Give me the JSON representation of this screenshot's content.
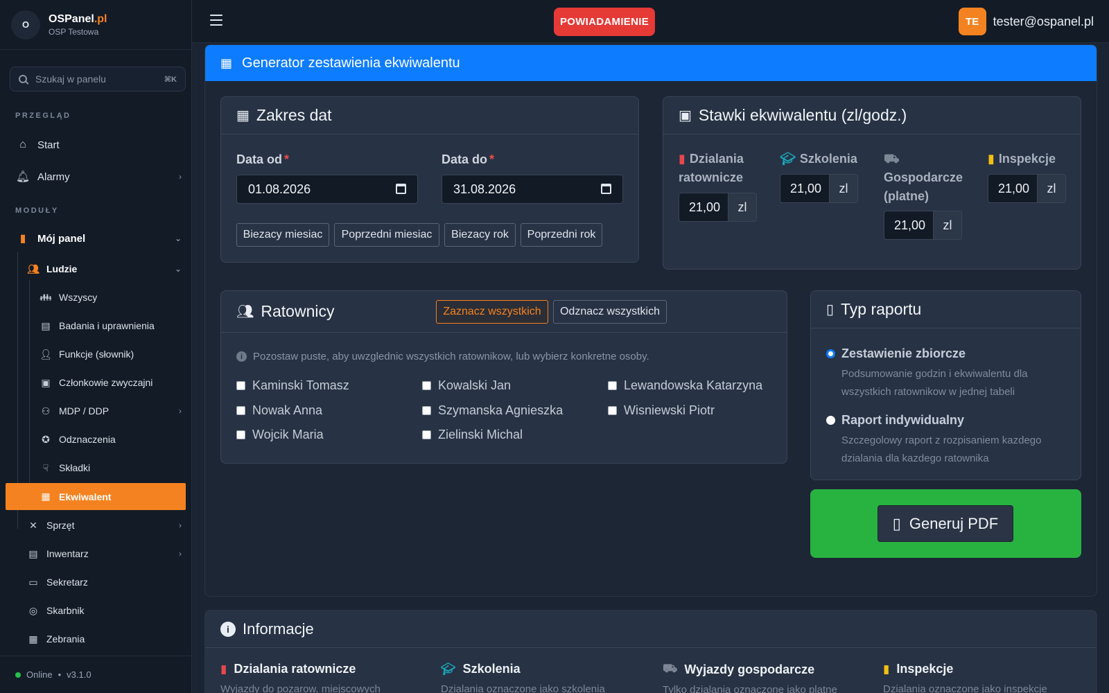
{
  "brand": {
    "logo": "O",
    "name": "OSPanel",
    "tld": ".pl",
    "unit": "OSP Testowa"
  },
  "search": {
    "placeholder": "Szukaj w panelu",
    "shortcut": "⌘K"
  },
  "sidebar": {
    "section_overview": "PRZEGLĄD",
    "section_modules": "MODUŁY",
    "items": [
      {
        "label": "Start",
        "icon": "home-icon"
      },
      {
        "label": "Alarmy",
        "icon": "bell-icon"
      },
      {
        "label": "Mój panel",
        "icon": "fire-extinguisher-icon"
      },
      {
        "label": "Ludzie",
        "icon": "users-icon"
      },
      {
        "label": "Wszyscy",
        "icon": "users-group-icon"
      },
      {
        "label": "Badania i uprawnienia",
        "icon": "medical-file-icon"
      },
      {
        "label": "Funkcje (słownik)",
        "icon": "user-tag-icon"
      },
      {
        "label": "Członkowie zwyczajni",
        "icon": "id-card-icon"
      },
      {
        "label": "MDP / DDP",
        "icon": "children-icon"
      },
      {
        "label": "Odznaczenia",
        "icon": "medal-icon"
      },
      {
        "label": "Składki",
        "icon": "hand-coin-icon"
      },
      {
        "label": "Ekwiwalent",
        "icon": "calculator-icon"
      },
      {
        "label": "Sprzęt",
        "icon": "tools-icon"
      },
      {
        "label": "Inwentarz",
        "icon": "book-icon"
      },
      {
        "label": "Sekretarz",
        "icon": "folder-icon"
      },
      {
        "label": "Skarbnik",
        "icon": "coins-icon"
      },
      {
        "label": "Zebrania",
        "icon": "calendar-check-icon"
      }
    ],
    "status": "Online",
    "version": "v3.1.0"
  },
  "topbar": {
    "notification": "POWIADAMIENIE",
    "avatar_initials": "TE",
    "user_email": "tester@ospanel.pl"
  },
  "main": {
    "title": "Generator zestawienia ekwiwalentu",
    "date_range": {
      "title": "Zakres dat",
      "from_label": "Data od",
      "from_value": "01.08.2026",
      "to_label": "Data do",
      "to_value": "31.08.2026",
      "required_mark": "*",
      "presets": [
        "Biezacy miesiac",
        "Poprzedni miesiac",
        "Biezacy rok",
        "Poprzedni rok"
      ]
    },
    "rates": {
      "title": "Stawki ekwiwalentu (zl/godz.)",
      "unit": "zl",
      "items": [
        {
          "label_line1": "Dzialania",
          "label_line2": "ratownicze",
          "value": "21,00",
          "icon": "fire-extinguisher-icon",
          "color": "#e5484d"
        },
        {
          "label_line1": "Szkolenia",
          "label_line2": "",
          "value": "21,00",
          "icon": "graduation-cap-icon",
          "color": "#1aa7b8"
        },
        {
          "label_line1": "Gospodarcze",
          "label_line2": "(platne)",
          "value": "21,00",
          "icon": "truck-icon",
          "color": "#7d8796"
        },
        {
          "label_line1": "Inspekcje",
          "label_line2": "",
          "value": "21,00",
          "icon": "clipboard-check-icon",
          "color": "#f2c012"
        }
      ]
    },
    "rescuers": {
      "title": "Ratownicy",
      "select_all": "Zaznacz wszystkich",
      "deselect_all": "Odznacz wszystkich",
      "hint": "Pozostaw puste, aby uwzglednic wszystkich ratownikow, lub wybierz konkretne osoby.",
      "people": [
        "Kaminski Tomasz",
        "Kowalski Jan",
        "Lewandowska Katarzyna",
        "Nowak Anna",
        "Szymanska Agnieszka",
        "Wisniewski Piotr",
        "Wojcik Maria",
        "Zielinski Michal"
      ]
    },
    "report_type": {
      "title": "Typ raportu",
      "options": [
        {
          "label": "Zestawienie zbiorcze",
          "desc": "Podsumowanie godzin i ekwiwalentu dla wszystkich ratownikow w jednej tabeli",
          "selected": true
        },
        {
          "label": "Raport indywidualny",
          "desc": "Szczegolowy raport z rozpisaniem kazdego dzialania dla kazdego ratownika",
          "selected": false
        }
      ]
    },
    "generate_label": "Generuj PDF"
  },
  "info": {
    "title": "Informacje",
    "columns": [
      {
        "title": "Dzialania ratownicze",
        "desc": "Wyjazdy do pozarow, miejscowych",
        "icon": "fire-extinguisher-icon",
        "color": "#e5484d"
      },
      {
        "title": "Szkolenia",
        "desc": "Dzialania oznaczone jako szkolenia",
        "icon": "graduation-cap-icon",
        "color": "#1aa7b8"
      },
      {
        "title": "Wyjazdy gospodarcze",
        "desc": "Tylko dzialania oznaczone jako platne",
        "icon": "truck-icon",
        "color": "#7d8796"
      },
      {
        "title": "Inspekcje",
        "desc": "Dzialania oznaczone jako inspekcje",
        "icon": "clipboard-check-icon",
        "color": "#f2c012"
      }
    ]
  },
  "colors": {
    "accent": "#f58220",
    "primary": "#0d7cff",
    "success": "#28b341",
    "danger": "#e53a36"
  }
}
